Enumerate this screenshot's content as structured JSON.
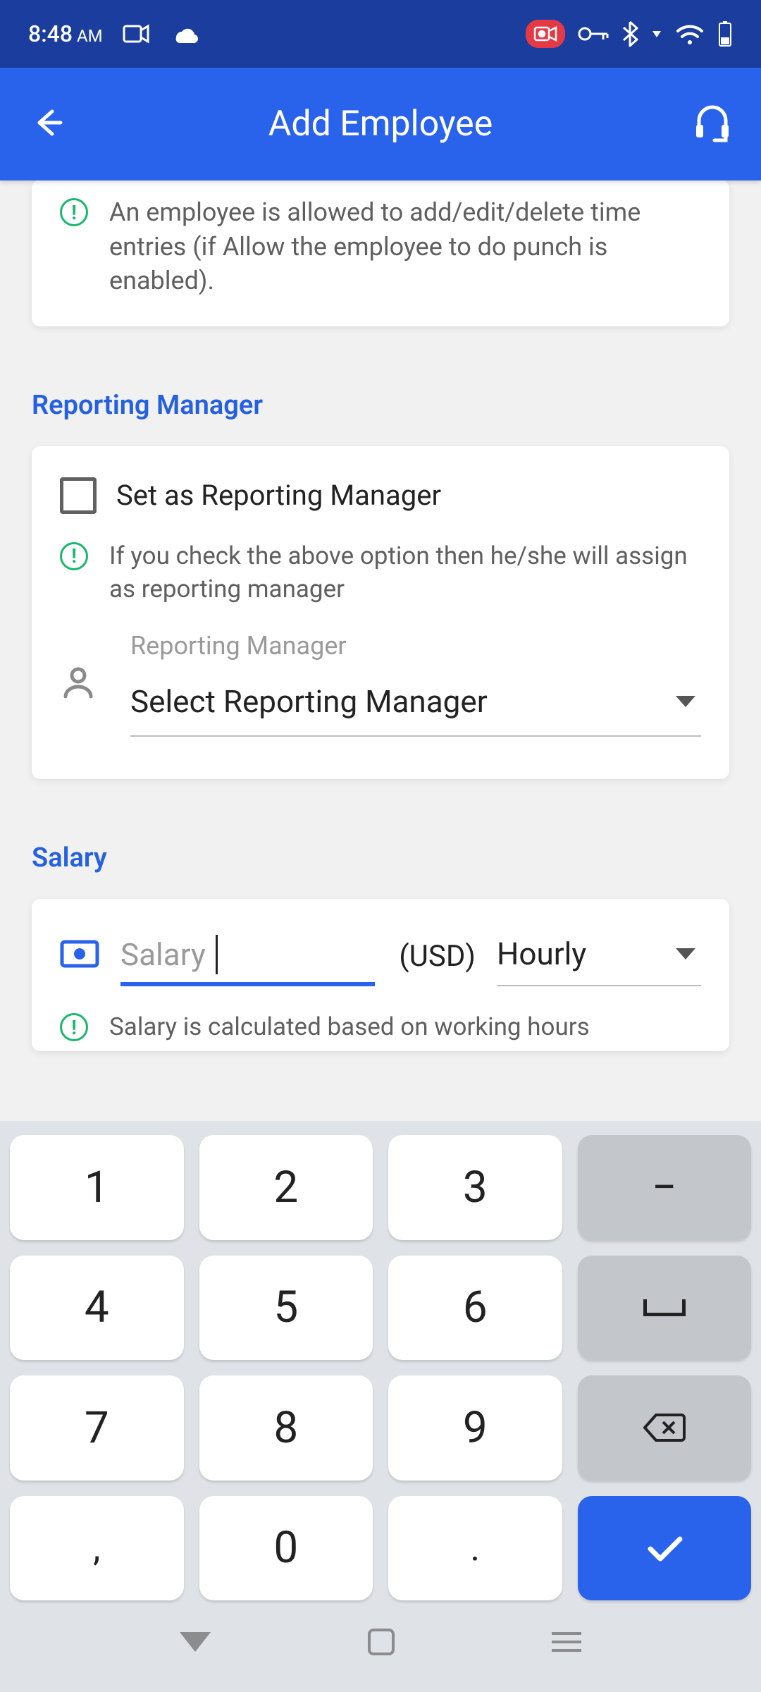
{
  "status": {
    "time": "8:48",
    "ampm": "AM"
  },
  "appbar": {
    "title": "Add Employee"
  },
  "note": {
    "text": "An employee is allowed to add/edit/delete time entries (if Allow the employee to do punch is enabled)."
  },
  "reporting": {
    "section_title": "Reporting Manager",
    "checkbox_label": "Set as Reporting Manager",
    "hint": "If you check the above option then he/she will assign as reporting manager",
    "field_label": "Reporting Manager",
    "select_placeholder": "Select Reporting Manager"
  },
  "salary": {
    "section_title": "Salary",
    "input_placeholder": "Salary",
    "currency": "(USD)",
    "period_selected": "Hourly",
    "hint": "Salary is calculated based on working hours"
  },
  "keypad": {
    "k1": "1",
    "k2": "2",
    "k3": "3",
    "k4": "4",
    "k5": "5",
    "k6": "6",
    "k7": "7",
    "k8": "8",
    "k9": "9",
    "k0": "0",
    "comma": ",",
    "dot": ".",
    "minus": "−"
  }
}
